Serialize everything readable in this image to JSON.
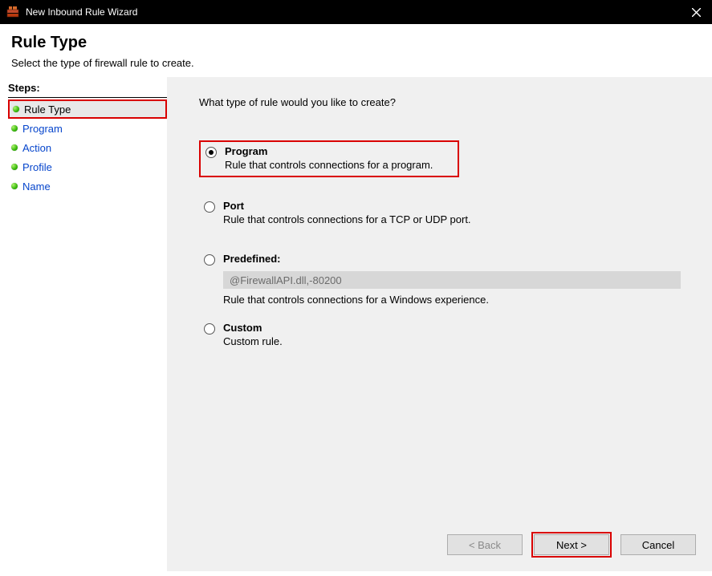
{
  "titlebar": {
    "title": "New Inbound Rule Wizard"
  },
  "header": {
    "heading": "Rule Type",
    "subtitle": "Select the type of firewall rule to create."
  },
  "steps": {
    "label": "Steps:",
    "items": [
      {
        "label": "Rule Type",
        "current": true
      },
      {
        "label": "Program"
      },
      {
        "label": "Action"
      },
      {
        "label": "Profile"
      },
      {
        "label": "Name"
      }
    ]
  },
  "main": {
    "question": "What type of rule would you like to create?",
    "options": [
      {
        "title": "Program",
        "desc": "Rule that controls connections for a program.",
        "selected": true,
        "highlighted": true
      },
      {
        "title": "Port",
        "desc": "Rule that controls connections for a TCP or UDP port."
      },
      {
        "title": "Predefined:",
        "desc": "Rule that controls connections for a Windows experience.",
        "predefined_value": "@FirewallAPI.dll,-80200"
      },
      {
        "title": "Custom",
        "desc": "Custom rule."
      }
    ]
  },
  "footer": {
    "back": "< Back",
    "next": "Next >",
    "cancel": "Cancel"
  }
}
